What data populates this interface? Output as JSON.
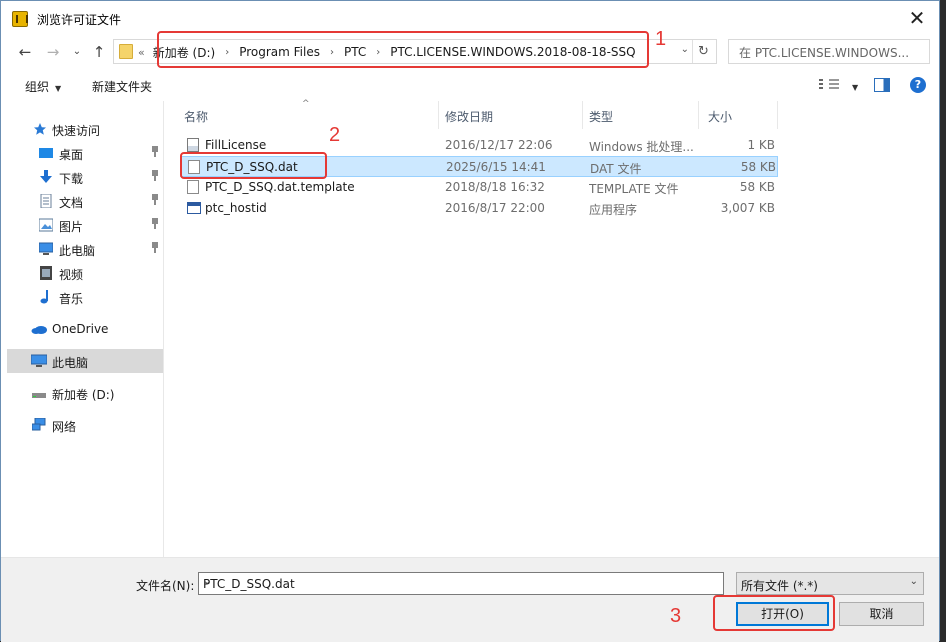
{
  "window": {
    "title": "浏览许可证文件",
    "close_glyph": "✕"
  },
  "nav": {
    "back": "←",
    "forward": "→",
    "recent": "⌄",
    "up": "↑",
    "overflow": "«",
    "breadcrumbs": [
      "新加卷 (D:)",
      "Program Files",
      "PTC",
      "PTC.LICENSE.WINDOWS.2018-08-18-SSQ"
    ],
    "separator": "›",
    "dropdown": "⌄",
    "refresh": "↻",
    "search_placeholder": "在 PTC.LICENSE.WINDOWS..."
  },
  "toolbar": {
    "organize": "组织",
    "organize_caret": "▼",
    "new_folder": "新建文件夹",
    "view_caret": "▼",
    "help": "?"
  },
  "sidebar": {
    "items": [
      {
        "label": "快速访问",
        "icon": "star-icon"
      },
      {
        "label": "桌面",
        "icon": "desktop-icon"
      },
      {
        "label": "下载",
        "icon": "download-icon"
      },
      {
        "label": "文档",
        "icon": "document-icon"
      },
      {
        "label": "图片",
        "icon": "picture-icon"
      },
      {
        "label": "此电脑",
        "icon": "computer-icon"
      },
      {
        "label": "视频",
        "icon": "video-icon"
      },
      {
        "label": "音乐",
        "icon": "music-icon"
      },
      {
        "label": "OneDrive",
        "icon": "cloud-icon"
      },
      {
        "label": "此电脑",
        "icon": "computer-icon"
      },
      {
        "label": "新加卷 (D:)",
        "icon": "drive-icon"
      },
      {
        "label": "网络",
        "icon": "network-icon"
      }
    ]
  },
  "files": {
    "columns": [
      "名称",
      "修改日期",
      "类型",
      "大小"
    ],
    "sort_glyph": "^",
    "rows": [
      {
        "name": "FillLicense",
        "date": "2016/12/17 22:06",
        "type": "Windows 批处理...",
        "size": "1 KB"
      },
      {
        "name": "PTC_D_SSQ.dat",
        "date": "2025/6/15 14:41",
        "type": "DAT 文件",
        "size": "58 KB"
      },
      {
        "name": "PTC_D_SSQ.dat.template",
        "date": "2018/8/18 16:32",
        "type": "TEMPLATE 文件",
        "size": "58 KB"
      },
      {
        "name": "ptc_hostid",
        "date": "2016/8/17 22:00",
        "type": "应用程序",
        "size": "3,007 KB"
      }
    ]
  },
  "footer": {
    "filename_label": "文件名(N):",
    "filename_value": "PTC_D_SSQ.dat",
    "filter_value": "所有文件 (*.*)",
    "dropdown": "⌄",
    "open_button": "打开(O)",
    "cancel_button": "取消"
  },
  "annotations": {
    "one": "1",
    "two": "2",
    "three": "3",
    "color": "#e53935"
  }
}
